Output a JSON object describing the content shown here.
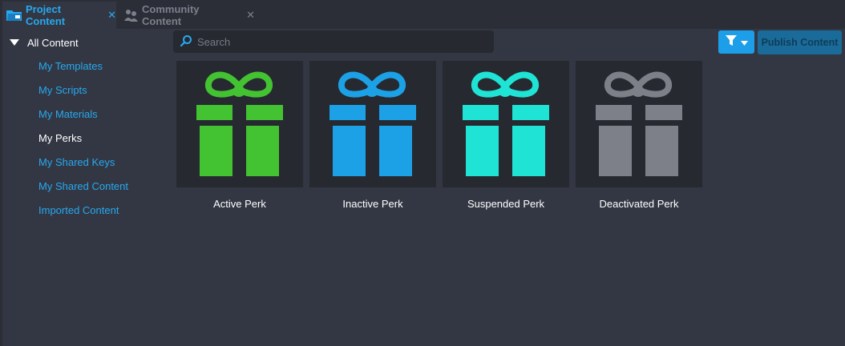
{
  "tabs": [
    {
      "label": "Project Content",
      "close": "✕"
    },
    {
      "label": "Community Content",
      "close": "✕"
    }
  ],
  "sidebar": {
    "root_label": "All Content",
    "items": [
      {
        "label": "My Templates"
      },
      {
        "label": "My Scripts"
      },
      {
        "label": "My Materials"
      },
      {
        "label": "My Perks"
      },
      {
        "label": "My Shared Keys"
      },
      {
        "label": "My Shared Content"
      },
      {
        "label": "Imported Content"
      }
    ]
  },
  "search": {
    "placeholder": "Search"
  },
  "toolbar": {
    "publish_label": "Publish Content",
    "filter_icon": "filter-icon"
  },
  "perks": [
    {
      "label": "Active Perk",
      "color": "#43c232"
    },
    {
      "label": "Inactive Perk",
      "color": "#1ca0e6"
    },
    {
      "label": "Suspended Perk",
      "color": "#1fe3d4"
    },
    {
      "label": "Deactivated Perk",
      "color": "#7e8089"
    }
  ],
  "colors": {
    "accent": "#26a9f0",
    "selected_nav": "#ffffff"
  }
}
